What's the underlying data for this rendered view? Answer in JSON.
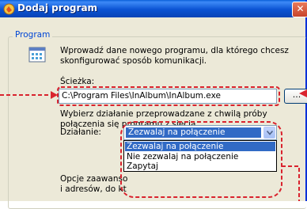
{
  "window": {
    "title": "Dodaj program",
    "close_glyph": "✕"
  },
  "group": {
    "label": "Program"
  },
  "intro_text": {
    "line1": "Wprowadź dane nowego programu, dla którego chcesz",
    "line2": "skonfigurować sposób komunikacji."
  },
  "path": {
    "label": "Ścieżka:",
    "value": "C:\\Program Files\\InAlbum\\InAlbum.exe",
    "browse_label": "..."
  },
  "action_text": {
    "line1": "Wybierz działanie przeprowadzane z chwilą próby",
    "line2": "połączenia się programu z siecią."
  },
  "action": {
    "label": "Działanie:",
    "selected": "Zezwalaj na połączenie",
    "options": [
      "Zezwalaj na połączenie",
      "Nie zezwalaj na połączenie",
      "Zapytaj"
    ]
  },
  "advanced_text": {
    "line1_visible": "Opcje zaawanso",
    "line2_visible": "i adresów, do kt"
  },
  "colors": {
    "annotation": "#d9232e",
    "selection": "#316ac5",
    "group_label": "#0046d5"
  },
  "icons": {
    "app": "firewall-shield-icon",
    "program": "program-window-icon",
    "dropdown": "chevron-down-icon"
  }
}
